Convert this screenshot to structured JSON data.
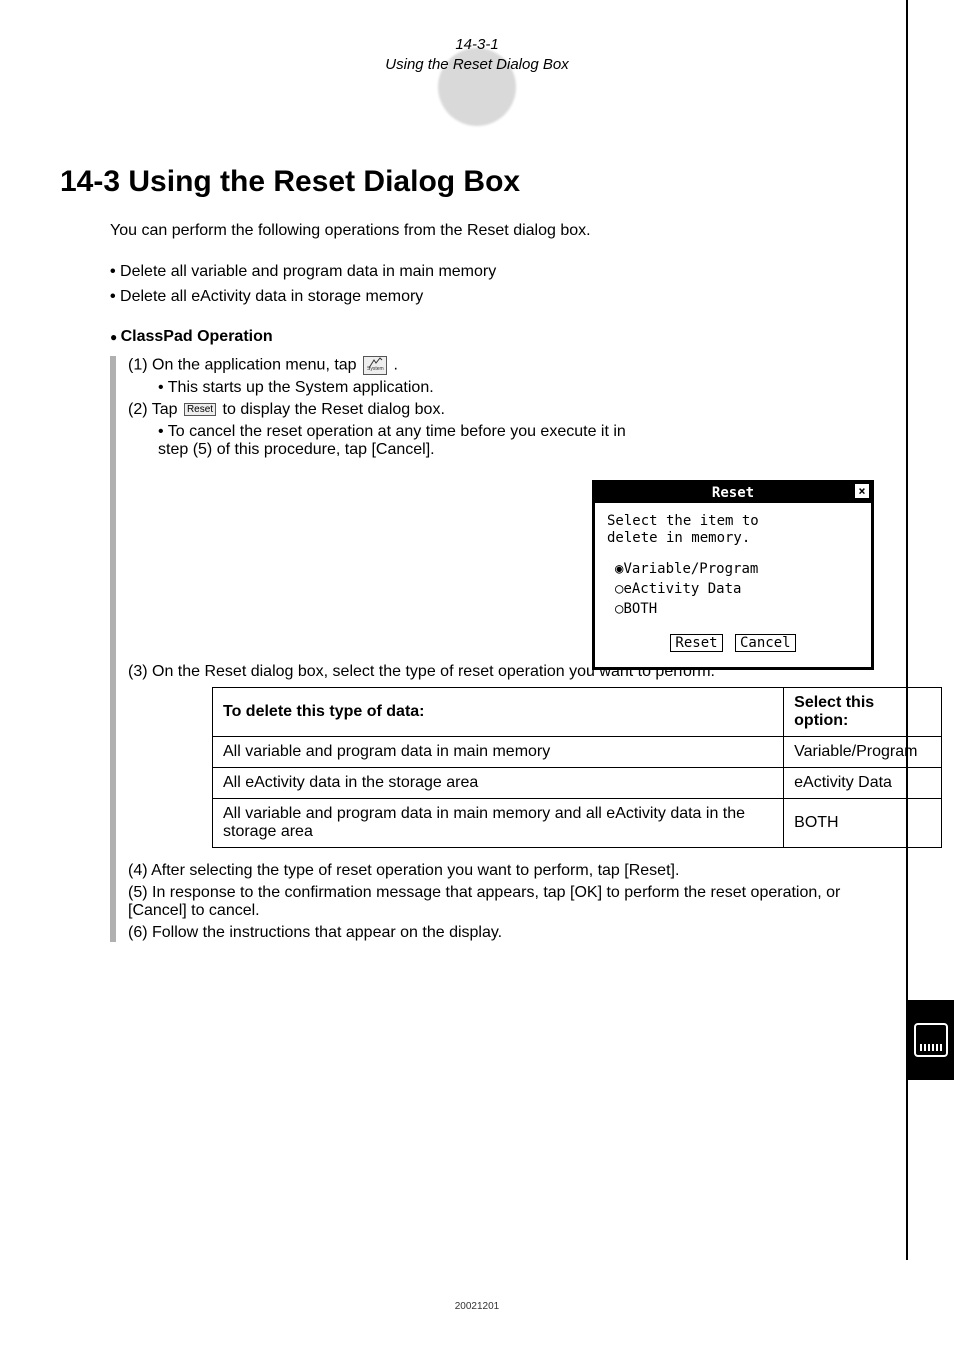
{
  "header": {
    "ref": "14-3-1",
    "title": "Using the Reset Dialog Box"
  },
  "section": {
    "number_title": "14-3 Using the Reset Dialog Box"
  },
  "intro": "You can perform the following operations from the Reset dialog box.",
  "intro_bullets": [
    "Delete all variable and program data in main memory",
    "Delete all eActivity data in storage memory"
  ],
  "operation_heading": "ClassPad Operation",
  "steps": {
    "s1": "(1) On the application menu, tap ",
    "s1_after": ".",
    "s1_sub": "This starts up the System application.",
    "s2_before": "(2) Tap ",
    "s2_after": " to display the Reset dialog box.",
    "s2_sub": "To cancel the reset operation at any time before you execute it in step (5) of this procedure, tap [Cancel].",
    "s3": "(3) On the Reset dialog box, select the type of reset operation you want to perform.",
    "s4": "(4) After selecting the type of reset operation you want to perform, tap [Reset].",
    "s5": "(5) In response to the confirmation message that appears, tap [OK] to perform the reset operation, or [Cancel] to cancel.",
    "s6": "(6) Follow the instructions that appear on the display."
  },
  "icons": {
    "system_icon": "System",
    "reset_icon": "Reset"
  },
  "dialog": {
    "title": "Reset",
    "msg_l1": "Select the item to",
    "msg_l2": "delete in memory.",
    "opt1": "Variable/Program",
    "opt2": "eActivity Data",
    "opt3": "BOTH",
    "btn_reset": "Reset",
    "btn_cancel": "Cancel"
  },
  "table": {
    "h1": "To delete this type of data:",
    "h2": "Select this option:",
    "rows": [
      {
        "c1": "All variable and program data in main memory",
        "c2": "Variable/Program"
      },
      {
        "c1": "All eActivity data in the storage area",
        "c2": "eActivity Data"
      },
      {
        "c1": "All variable and program data in main memory and all eActivity data in the storage area",
        "c2": "BOTH"
      }
    ]
  },
  "footer": {
    "num": "20021201"
  }
}
